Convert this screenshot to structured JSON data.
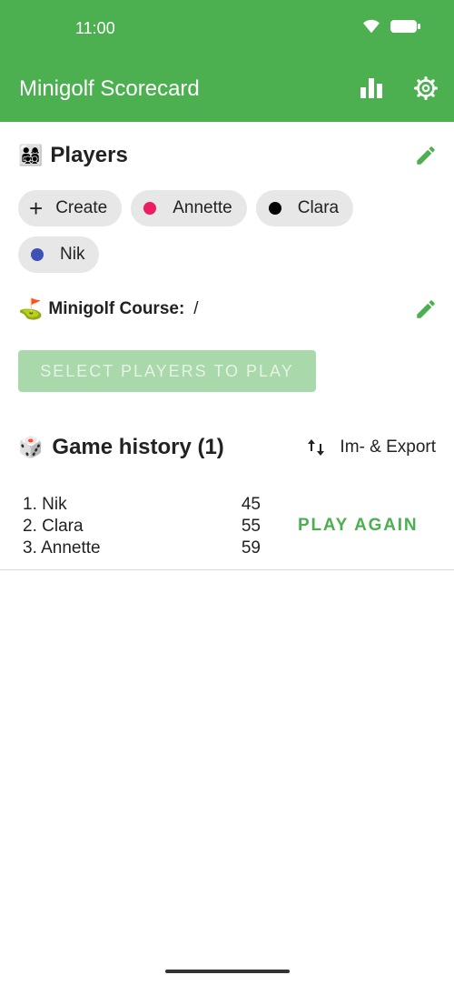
{
  "status_bar": {
    "time": "11:00"
  },
  "app_bar": {
    "title": "Minigolf Scorecard",
    "accent": "#4caf50"
  },
  "players": {
    "emoji": "👨‍👩‍👧‍👦",
    "title": "Players",
    "chips": [
      {
        "label": "Create",
        "type": "create"
      },
      {
        "label": "Annette",
        "color": "#e91e63"
      },
      {
        "label": "Clara",
        "color": "#000000"
      },
      {
        "label": "Nik",
        "color": "#3f51b5"
      }
    ]
  },
  "course": {
    "emoji": "⛳",
    "label": "Minigolf Course:",
    "value": "/"
  },
  "select_button": {
    "label": "SELECT PLAYERS TO PLAY"
  },
  "history": {
    "emoji": "🎲",
    "title": "Game history (1)",
    "export_label": "Im- & Export",
    "rows": [
      {
        "name": "1. Nik",
        "score": "45"
      },
      {
        "name": "2. Clara",
        "score": "55"
      },
      {
        "name": "3. Annette",
        "score": "59"
      }
    ],
    "play_again": "PLAY AGAIN"
  }
}
